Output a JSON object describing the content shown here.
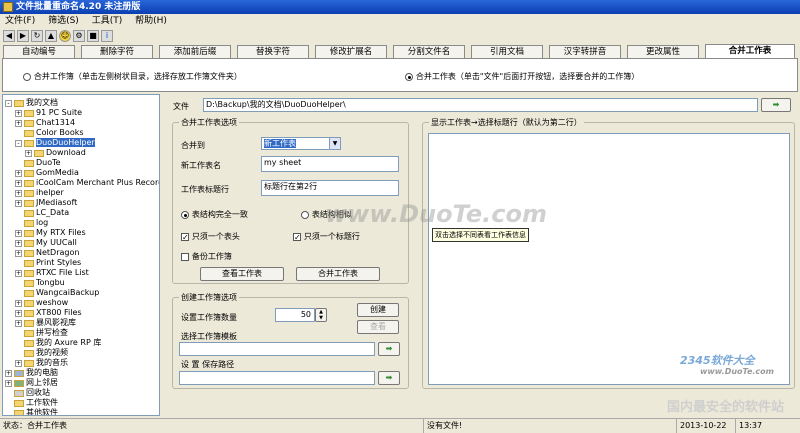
{
  "window": {
    "title": "文件批量重命名4.20 未注册版"
  },
  "menu": [
    "文件(F)",
    "筛选(S)",
    "工具(T)",
    "帮助(H)"
  ],
  "toolbar_icons": [
    "back-icon",
    "forward-icon",
    "refresh-icon",
    "up-icon",
    "smiley-icon",
    "settings-icon",
    "lock-icon",
    "info-icon"
  ],
  "tabs": [
    "自动编号",
    "删除字符",
    "添加前后缀",
    "替换字符",
    "修改扩展名",
    "分割文件名",
    "引用文档",
    "汉字转拼音",
    "更改属性",
    "合并工作表"
  ],
  "mode": {
    "option1": "合并工作簿（单击左侧树状目录，选择存放工作簿文件夹）",
    "option2": "合并工作表（单击\"文件\"后面打开按钮，选择要合并的工作簿）"
  },
  "tree": [
    {
      "label": "我的文档",
      "depth": 0,
      "toggle": "-",
      "folder": "doc"
    },
    {
      "label": "91 PC Suite",
      "depth": 1,
      "toggle": "+"
    },
    {
      "label": "Chat1314",
      "depth": 1,
      "toggle": "+"
    },
    {
      "label": "Color Books",
      "depth": 1,
      "toggle": ""
    },
    {
      "label": "DuoDuoHelper",
      "depth": 1,
      "toggle": "-",
      "selected": true
    },
    {
      "label": "Download",
      "depth": 2,
      "toggle": "+"
    },
    {
      "label": "DuoTe",
      "depth": 1,
      "toggle": ""
    },
    {
      "label": "GomMedia",
      "depth": 1,
      "toggle": "+"
    },
    {
      "label": "iCoolCam Merchant Plus Records Fil",
      "depth": 1,
      "toggle": "+"
    },
    {
      "label": "ihelper",
      "depth": 1,
      "toggle": "+"
    },
    {
      "label": "JMediasoft",
      "depth": 1,
      "toggle": "+"
    },
    {
      "label": "LC_Data",
      "depth": 1,
      "toggle": ""
    },
    {
      "label": "log",
      "depth": 1,
      "toggle": ""
    },
    {
      "label": "My RTX Files",
      "depth": 1,
      "toggle": "+"
    },
    {
      "label": "My UUCall",
      "depth": 1,
      "toggle": "+"
    },
    {
      "label": "NetDragon",
      "depth": 1,
      "toggle": "+"
    },
    {
      "label": "Print Styles",
      "depth": 1,
      "toggle": ""
    },
    {
      "label": "RTXC File List",
      "depth": 1,
      "toggle": "+"
    },
    {
      "label": "Tongbu",
      "depth": 1,
      "toggle": ""
    },
    {
      "label": "WangcaiBackup",
      "depth": 1,
      "toggle": ""
    },
    {
      "label": "weshow",
      "depth": 1,
      "toggle": "+"
    },
    {
      "label": "XT800 Files",
      "depth": 1,
      "toggle": "+"
    },
    {
      "label": "暴风影视库",
      "depth": 1,
      "toggle": "+"
    },
    {
      "label": "拼写检查",
      "depth": 1,
      "toggle": ""
    },
    {
      "label": "我的 Axure RP 库",
      "depth": 1,
      "toggle": ""
    },
    {
      "label": "我的视频",
      "depth": 1,
      "toggle": ""
    },
    {
      "label": "我的音乐",
      "depth": 1,
      "toggle": "+"
    },
    {
      "label": "我的电脑",
      "depth": 0,
      "toggle": "+",
      "folder": "pc"
    },
    {
      "label": "网上邻居",
      "depth": 0,
      "toggle": "+",
      "folder": "net"
    },
    {
      "label": "回收站",
      "depth": 0,
      "toggle": "",
      "folder": "bin"
    },
    {
      "label": "工作软件",
      "depth": 0,
      "toggle": ""
    },
    {
      "label": "其他软件",
      "depth": 0,
      "toggle": ""
    }
  ],
  "file": {
    "label": "文件",
    "value": "D:\\Backup\\我的文档\\DuoDuoHelper\\"
  },
  "merge": {
    "group_title": "合并工作表选项",
    "merge_to_label": "合并到",
    "merge_to_value": "新工作表",
    "new_sheet_label": "新工作表名",
    "new_sheet_value": "my sheet",
    "header_label": "工作表标题行",
    "header_value": "标题行在第2行",
    "radio_same": "表结构完全一致",
    "radio_diff": "表结构相似",
    "check_one_header": "只须一个表头",
    "check_one_title": "只须一个标题行",
    "check_backup": "备份工作簿",
    "btn_view": "查看工作表",
    "btn_merge": "合并工作表"
  },
  "create": {
    "group_title": "创建工作簿选项",
    "count_label": "设置工作簿数量",
    "count_value": "50",
    "btn_create": "创建",
    "btn_view": "查看",
    "template_label": "选择工作簿模板",
    "template_value": "",
    "save_label": "设 置 保存路径",
    "save_value": ""
  },
  "preview": {
    "title": "显示工作表→选择标题行（默认为第二行）",
    "hint": "双击选择不同表看工作表信息"
  },
  "status": {
    "state": "状态：合并工作表",
    "file": "没有文件!",
    "date": "2013-10-22",
    "time": "13:37"
  },
  "watermarks": {
    "center": "www.DuoTe.com",
    "brand": "2345软件大全",
    "url": "www.DuoTe.com",
    "slogan": "国内最安全的软件站"
  },
  "colors": {
    "title_bar": "#0a3fb3",
    "selection": "#316ac5",
    "window_bg": "#ece9d8"
  }
}
